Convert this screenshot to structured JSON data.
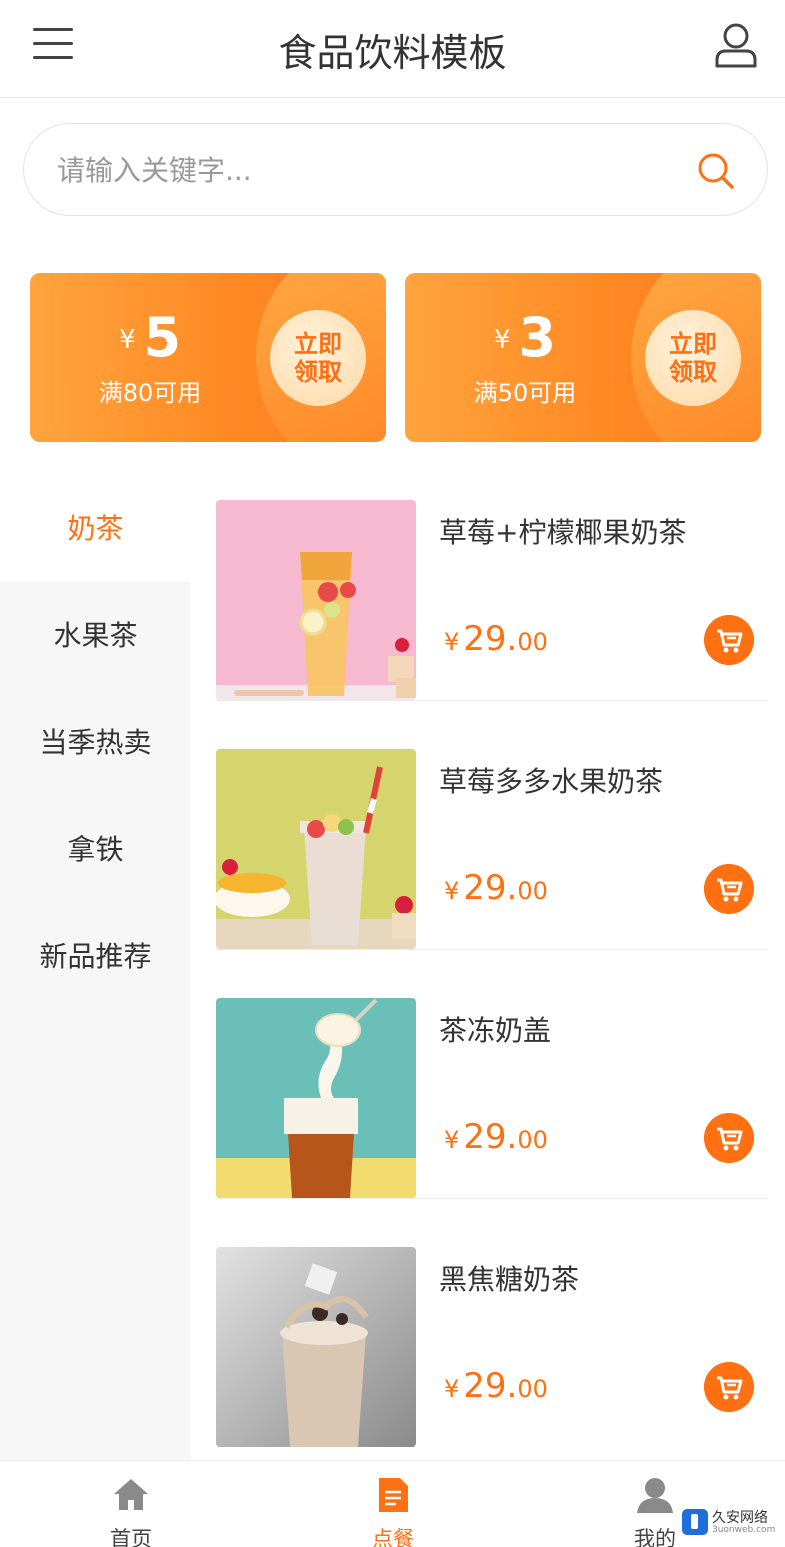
{
  "header": {
    "title": "食品饮料模板",
    "menu_icon": "menu-icon",
    "user_icon": "user-icon"
  },
  "search": {
    "placeholder": "请输入关键字...",
    "value": "",
    "icon": "search-icon"
  },
  "coupons": [
    {
      "symbol": "¥",
      "amount": "5",
      "condition": "满80可用",
      "action": "立即领取"
    },
    {
      "symbol": "¥",
      "amount": "3",
      "condition": "满50可用",
      "action": "立即领取"
    }
  ],
  "categories": [
    {
      "label": "奶茶",
      "active": true
    },
    {
      "label": "水果茶",
      "active": false
    },
    {
      "label": "当季热卖",
      "active": false
    },
    {
      "label": "拿铁",
      "active": false
    },
    {
      "label": "新品推荐",
      "active": false
    }
  ],
  "products": [
    {
      "name": "草莓+柠檬椰果奶茶",
      "symbol": "¥",
      "price_int": "29.",
      "price_dec": "00",
      "image": "strawberry-lemon-tea"
    },
    {
      "name": "草莓多多水果奶茶",
      "symbol": "¥",
      "price_int": "29.",
      "price_dec": "00",
      "image": "strawberry-fruit-milk-tea"
    },
    {
      "name": "茶冻奶盖",
      "symbol": "¥",
      "price_int": "29.",
      "price_dec": "00",
      "image": "tea-jelly-milk-cap"
    },
    {
      "name": "黑焦糖奶茶",
      "symbol": "¥",
      "price_int": "29.",
      "price_dec": "00",
      "image": "black-caramel-milk-tea"
    }
  ],
  "tabbar": [
    {
      "label": "首页",
      "icon": "home-icon",
      "active": false
    },
    {
      "label": "点餐",
      "icon": "order-icon",
      "active": true
    },
    {
      "label": "我的",
      "icon": "profile-icon",
      "active": false
    }
  ],
  "watermark": {
    "line1": "久安网络",
    "line2": "3uonweb.com"
  },
  "colors": {
    "accent": "#ff7012",
    "coupon": "#ff8a24",
    "sidebar_bg": "#f7f7f7"
  }
}
